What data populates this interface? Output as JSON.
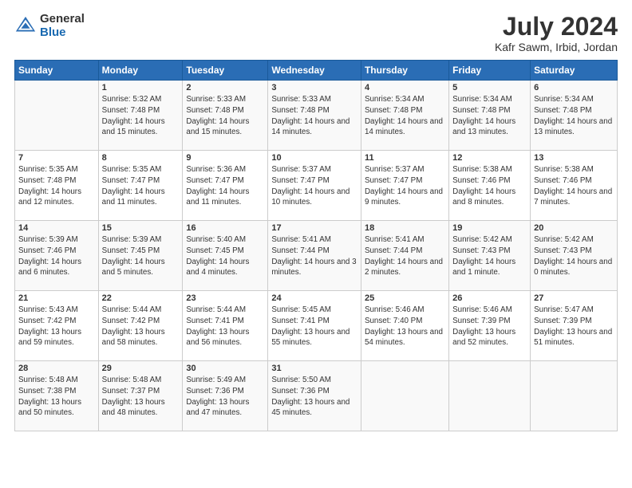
{
  "logo": {
    "general": "General",
    "blue": "Blue"
  },
  "title": "July 2024",
  "subtitle": "Kafr Sawm, Irbid, Jordan",
  "days_header": [
    "Sunday",
    "Monday",
    "Tuesday",
    "Wednesday",
    "Thursday",
    "Friday",
    "Saturday"
  ],
  "weeks": [
    [
      {
        "num": "",
        "sunrise": "",
        "sunset": "",
        "daylight": ""
      },
      {
        "num": "1",
        "sunrise": "Sunrise: 5:32 AM",
        "sunset": "Sunset: 7:48 PM",
        "daylight": "Daylight: 14 hours and 15 minutes."
      },
      {
        "num": "2",
        "sunrise": "Sunrise: 5:33 AM",
        "sunset": "Sunset: 7:48 PM",
        "daylight": "Daylight: 14 hours and 15 minutes."
      },
      {
        "num": "3",
        "sunrise": "Sunrise: 5:33 AM",
        "sunset": "Sunset: 7:48 PM",
        "daylight": "Daylight: 14 hours and 14 minutes."
      },
      {
        "num": "4",
        "sunrise": "Sunrise: 5:34 AM",
        "sunset": "Sunset: 7:48 PM",
        "daylight": "Daylight: 14 hours and 14 minutes."
      },
      {
        "num": "5",
        "sunrise": "Sunrise: 5:34 AM",
        "sunset": "Sunset: 7:48 PM",
        "daylight": "Daylight: 14 hours and 13 minutes."
      },
      {
        "num": "6",
        "sunrise": "Sunrise: 5:34 AM",
        "sunset": "Sunset: 7:48 PM",
        "daylight": "Daylight: 14 hours and 13 minutes."
      }
    ],
    [
      {
        "num": "7",
        "sunrise": "Sunrise: 5:35 AM",
        "sunset": "Sunset: 7:48 PM",
        "daylight": "Daylight: 14 hours and 12 minutes."
      },
      {
        "num": "8",
        "sunrise": "Sunrise: 5:35 AM",
        "sunset": "Sunset: 7:47 PM",
        "daylight": "Daylight: 14 hours and 11 minutes."
      },
      {
        "num": "9",
        "sunrise": "Sunrise: 5:36 AM",
        "sunset": "Sunset: 7:47 PM",
        "daylight": "Daylight: 14 hours and 11 minutes."
      },
      {
        "num": "10",
        "sunrise": "Sunrise: 5:37 AM",
        "sunset": "Sunset: 7:47 PM",
        "daylight": "Daylight: 14 hours and 10 minutes."
      },
      {
        "num": "11",
        "sunrise": "Sunrise: 5:37 AM",
        "sunset": "Sunset: 7:47 PM",
        "daylight": "Daylight: 14 hours and 9 minutes."
      },
      {
        "num": "12",
        "sunrise": "Sunrise: 5:38 AM",
        "sunset": "Sunset: 7:46 PM",
        "daylight": "Daylight: 14 hours and 8 minutes."
      },
      {
        "num": "13",
        "sunrise": "Sunrise: 5:38 AM",
        "sunset": "Sunset: 7:46 PM",
        "daylight": "Daylight: 14 hours and 7 minutes."
      }
    ],
    [
      {
        "num": "14",
        "sunrise": "Sunrise: 5:39 AM",
        "sunset": "Sunset: 7:46 PM",
        "daylight": "Daylight: 14 hours and 6 minutes."
      },
      {
        "num": "15",
        "sunrise": "Sunrise: 5:39 AM",
        "sunset": "Sunset: 7:45 PM",
        "daylight": "Daylight: 14 hours and 5 minutes."
      },
      {
        "num": "16",
        "sunrise": "Sunrise: 5:40 AM",
        "sunset": "Sunset: 7:45 PM",
        "daylight": "Daylight: 14 hours and 4 minutes."
      },
      {
        "num": "17",
        "sunrise": "Sunrise: 5:41 AM",
        "sunset": "Sunset: 7:44 PM",
        "daylight": "Daylight: 14 hours and 3 minutes."
      },
      {
        "num": "18",
        "sunrise": "Sunrise: 5:41 AM",
        "sunset": "Sunset: 7:44 PM",
        "daylight": "Daylight: 14 hours and 2 minutes."
      },
      {
        "num": "19",
        "sunrise": "Sunrise: 5:42 AM",
        "sunset": "Sunset: 7:43 PM",
        "daylight": "Daylight: 14 hours and 1 minute."
      },
      {
        "num": "20",
        "sunrise": "Sunrise: 5:42 AM",
        "sunset": "Sunset: 7:43 PM",
        "daylight": "Daylight: 14 hours and 0 minutes."
      }
    ],
    [
      {
        "num": "21",
        "sunrise": "Sunrise: 5:43 AM",
        "sunset": "Sunset: 7:42 PM",
        "daylight": "Daylight: 13 hours and 59 minutes."
      },
      {
        "num": "22",
        "sunrise": "Sunrise: 5:44 AM",
        "sunset": "Sunset: 7:42 PM",
        "daylight": "Daylight: 13 hours and 58 minutes."
      },
      {
        "num": "23",
        "sunrise": "Sunrise: 5:44 AM",
        "sunset": "Sunset: 7:41 PM",
        "daylight": "Daylight: 13 hours and 56 minutes."
      },
      {
        "num": "24",
        "sunrise": "Sunrise: 5:45 AM",
        "sunset": "Sunset: 7:41 PM",
        "daylight": "Daylight: 13 hours and 55 minutes."
      },
      {
        "num": "25",
        "sunrise": "Sunrise: 5:46 AM",
        "sunset": "Sunset: 7:40 PM",
        "daylight": "Daylight: 13 hours and 54 minutes."
      },
      {
        "num": "26",
        "sunrise": "Sunrise: 5:46 AM",
        "sunset": "Sunset: 7:39 PM",
        "daylight": "Daylight: 13 hours and 52 minutes."
      },
      {
        "num": "27",
        "sunrise": "Sunrise: 5:47 AM",
        "sunset": "Sunset: 7:39 PM",
        "daylight": "Daylight: 13 hours and 51 minutes."
      }
    ],
    [
      {
        "num": "28",
        "sunrise": "Sunrise: 5:48 AM",
        "sunset": "Sunset: 7:38 PM",
        "daylight": "Daylight: 13 hours and 50 minutes."
      },
      {
        "num": "29",
        "sunrise": "Sunrise: 5:48 AM",
        "sunset": "Sunset: 7:37 PM",
        "daylight": "Daylight: 13 hours and 48 minutes."
      },
      {
        "num": "30",
        "sunrise": "Sunrise: 5:49 AM",
        "sunset": "Sunset: 7:36 PM",
        "daylight": "Daylight: 13 hours and 47 minutes."
      },
      {
        "num": "31",
        "sunrise": "Sunrise: 5:50 AM",
        "sunset": "Sunset: 7:36 PM",
        "daylight": "Daylight: 13 hours and 45 minutes."
      },
      {
        "num": "",
        "sunrise": "",
        "sunset": "",
        "daylight": ""
      },
      {
        "num": "",
        "sunrise": "",
        "sunset": "",
        "daylight": ""
      },
      {
        "num": "",
        "sunrise": "",
        "sunset": "",
        "daylight": ""
      }
    ]
  ]
}
